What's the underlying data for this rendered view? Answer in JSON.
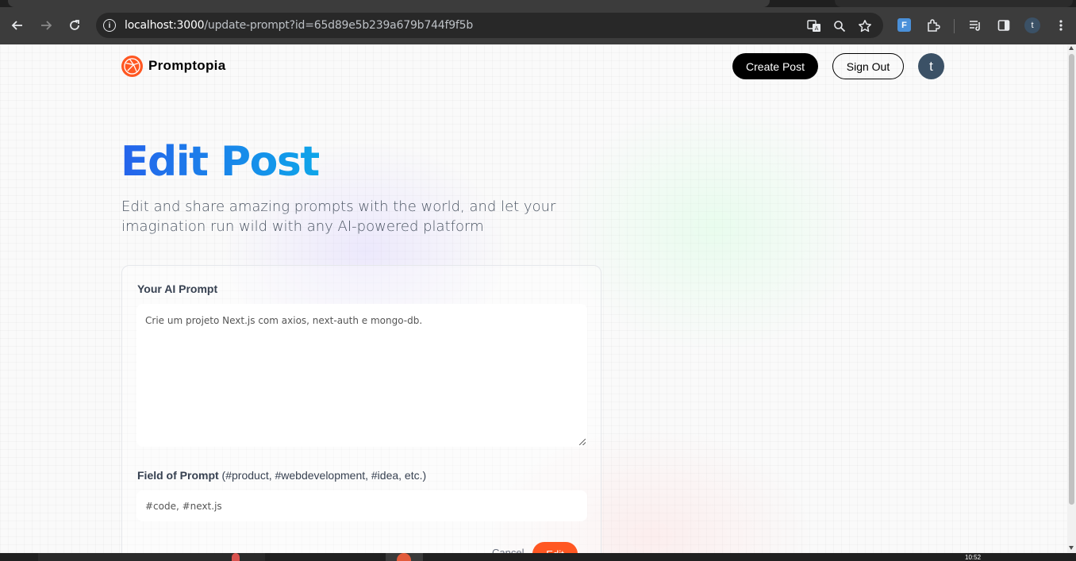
{
  "browser": {
    "address_host": "localhost:3000",
    "address_path": "/update-prompt?id=65d89e5b239a679b744f9f5b",
    "profile_initial": "t",
    "icons": [
      "back-icon",
      "forward-icon",
      "reload-icon",
      "site-info-icon",
      "translate-icon",
      "zoom-icon",
      "bookmark-star-icon",
      "extension-f-icon",
      "extensions-puzzle-icon",
      "reading-list-icon",
      "side-panel-icon",
      "profile-icon",
      "menu-icon"
    ]
  },
  "site": {
    "brand": "Promptopia",
    "create_post": "Create Post",
    "sign_out": "Sign Out",
    "avatar_initial": "t"
  },
  "page": {
    "title": "Edit Post",
    "description": "Edit and share amazing prompts with the world, and let your imagination run wild with any AI-powered platform"
  },
  "form": {
    "prompt_label": "Your AI Prompt",
    "prompt_value": "Crie um projeto Next.js com axios, next-auth e mongo-db.",
    "tag_label_bold": "Field of Prompt",
    "tag_label_hint": " (#product, #webdevelopment, #idea, etc.)",
    "tag_value": "#code, #next.js",
    "cancel": "Cancel",
    "submit": "Edit"
  },
  "taskbar": {
    "clock": "10:52"
  },
  "colors": {
    "accent_orange": "#ff5722",
    "title_gradient_start": "#2563eb",
    "title_gradient_end": "#0ea5e9"
  }
}
